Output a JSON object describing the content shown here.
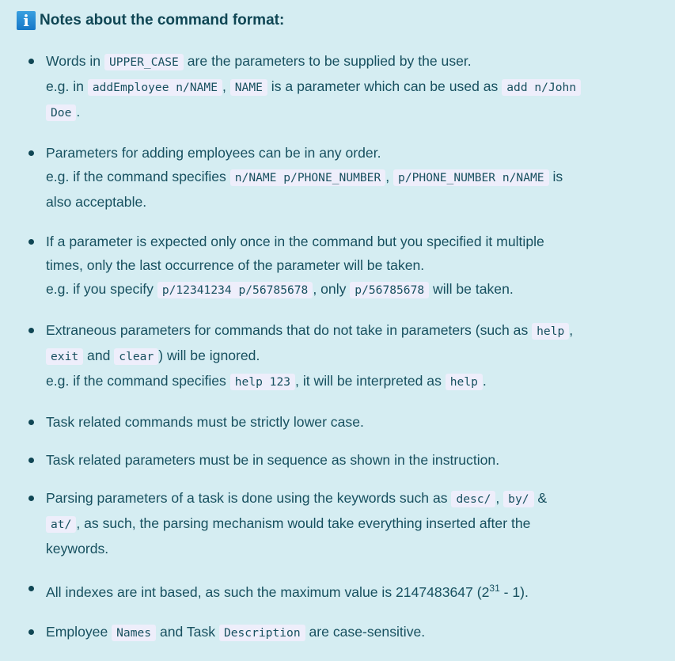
{
  "title": "Notes about the command format:",
  "info_icon": "i",
  "bullets": [
    [
      {
        "t": "Words in "
      },
      {
        "c": "UPPER_CASE"
      },
      {
        "t": " are the parameters to be supplied by the user."
      },
      {
        "br": 1
      },
      {
        "t": "e.g. in "
      },
      {
        "c": "addEmployee n/NAME"
      },
      {
        "t": ", "
      },
      {
        "c": "NAME"
      },
      {
        "t": " is a parameter which can be used as "
      },
      {
        "c": "add n/John"
      },
      {
        "br": 1
      },
      {
        "c": "Doe"
      },
      {
        "t": "."
      }
    ],
    [
      {
        "t": "Parameters for adding employees can be in any order."
      },
      {
        "br": 1
      },
      {
        "t": "e.g. if the command specifies "
      },
      {
        "c": "n/NAME p/PHONE_NUMBER"
      },
      {
        "t": ", "
      },
      {
        "c": "p/PHONE_NUMBER n/NAME"
      },
      {
        "t": " is"
      },
      {
        "br": 1
      },
      {
        "t": "also acceptable."
      }
    ],
    [
      {
        "t": "If a parameter is expected only once in the command but you specified it multiple"
      },
      {
        "br": 1
      },
      {
        "t": "times, only the last occurrence of the parameter will be taken."
      },
      {
        "br": 1
      },
      {
        "t": "e.g. if you specify "
      },
      {
        "c": "p/12341234 p/56785678"
      },
      {
        "t": ", only "
      },
      {
        "c": "p/56785678"
      },
      {
        "t": " will be taken."
      }
    ],
    [
      {
        "t": "Extraneous parameters for commands that do not take in parameters (such as "
      },
      {
        "c": "help"
      },
      {
        "t": ","
      },
      {
        "br": 1
      },
      {
        "c": "exit"
      },
      {
        "t": " and "
      },
      {
        "c": "clear"
      },
      {
        "t": ") will be ignored."
      },
      {
        "br": 1
      },
      {
        "t": "e.g. if the command specifies "
      },
      {
        "c": "help 123"
      },
      {
        "t": ", it will be interpreted as "
      },
      {
        "c": "help"
      },
      {
        "t": "."
      }
    ],
    [
      {
        "t": "Task related commands must be strictly lower case."
      }
    ],
    [
      {
        "t": "Task related parameters must be in sequence as shown in the instruction."
      }
    ],
    [
      {
        "t": "Parsing parameters of a task is done using the keywords such as "
      },
      {
        "c": "desc/"
      },
      {
        "t": ", "
      },
      {
        "c": "by/"
      },
      {
        "t": " &"
      },
      {
        "br": 1
      },
      {
        "c": "at/"
      },
      {
        "t": ", as such, the parsing mechanism would take everything inserted after the"
      },
      {
        "br": 1
      },
      {
        "t": "keywords."
      }
    ],
    [
      {
        "t": "All indexes are int based, as such the maximum value is 2147483647 (2"
      },
      {
        "s": "31"
      },
      {
        "t": " - 1)."
      }
    ],
    [
      {
        "t": "Employee "
      },
      {
        "c": "Names"
      },
      {
        "t": " and Task "
      },
      {
        "c": "Description"
      },
      {
        "t": " are case-sensitive."
      }
    ]
  ]
}
